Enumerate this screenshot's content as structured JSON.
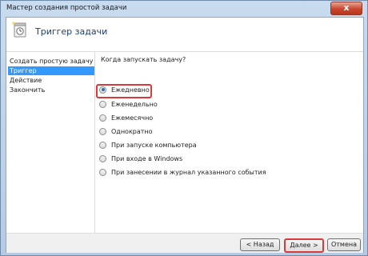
{
  "window": {
    "title": "Мастер создания простой задачи",
    "close_glyph": "x"
  },
  "header": {
    "title": "Триггер задачи",
    "icon": "task-wizard-icon"
  },
  "sidebar": {
    "items": [
      {
        "label": "Создать простую задачу",
        "active": false
      },
      {
        "label": "Триггер",
        "active": true
      },
      {
        "label": "Действие",
        "active": false
      },
      {
        "label": "Закончить",
        "active": false
      }
    ]
  },
  "main": {
    "question": "Когда запускать задачу?",
    "options": [
      {
        "label": "Ежедневно",
        "checked": true
      },
      {
        "label": "Еженедельно",
        "checked": false
      },
      {
        "label": "Ежемесячно",
        "checked": false
      },
      {
        "label": "Однократно",
        "checked": false
      },
      {
        "label": "При запуске компьютера",
        "checked": false
      },
      {
        "label": "При входе в Windows",
        "checked": false
      },
      {
        "label": "При занесении в журнал указанного события",
        "checked": false
      }
    ]
  },
  "footer": {
    "back": "< Назад",
    "next": "Далее >",
    "cancel": "Отмена"
  },
  "colors": {
    "highlight": "#d83a3a",
    "selection": "#3399ff",
    "header_text": "#1e3f6e"
  }
}
